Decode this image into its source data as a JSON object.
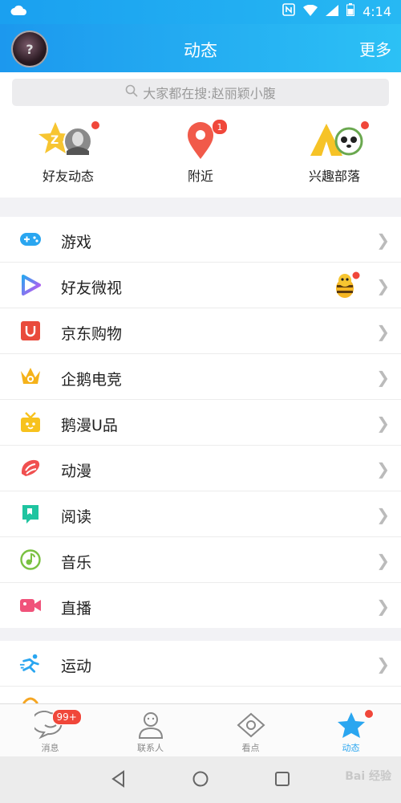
{
  "status_bar": {
    "time": "4:14"
  },
  "header": {
    "title": "动态",
    "more": "更多"
  },
  "search": {
    "placeholder": "大家都在搜:赵丽颖小腹"
  },
  "quick_actions": [
    {
      "label": "好友动态"
    },
    {
      "label": "附近",
      "badge": "1"
    },
    {
      "label": "兴趣部落"
    }
  ],
  "group1": [
    {
      "label": "游戏",
      "icon": "gamepad-icon",
      "color": "#2aa6f0"
    },
    {
      "label": "好友微视",
      "icon": "weishi-play-icon",
      "color": "#7b4df0"
    },
    {
      "label": "京东购物",
      "icon": "jd-shopping-icon",
      "color": "#e94b3c"
    },
    {
      "label": "企鹅电竞",
      "icon": "esports-crown-icon",
      "color": "#f5b21a"
    },
    {
      "label": "鹅漫U品",
      "icon": "gift-box-icon",
      "color": "#f7c21e"
    },
    {
      "label": "动漫",
      "icon": "comic-icon",
      "color": "#f05050"
    },
    {
      "label": "阅读",
      "icon": "book-icon",
      "color": "#1fc4a0"
    },
    {
      "label": "音乐",
      "icon": "music-icon",
      "color": "#7ac142"
    },
    {
      "label": "直播",
      "icon": "live-camera-icon",
      "color": "#f0527a"
    }
  ],
  "group2": [
    {
      "label": "运动",
      "icon": "running-icon",
      "color": "#2aa6f0"
    }
  ],
  "tabs": [
    {
      "label": "消息",
      "badge": "99+"
    },
    {
      "label": "联系人"
    },
    {
      "label": "看点"
    },
    {
      "label": "动态"
    }
  ],
  "watermark": "Bai 经验"
}
